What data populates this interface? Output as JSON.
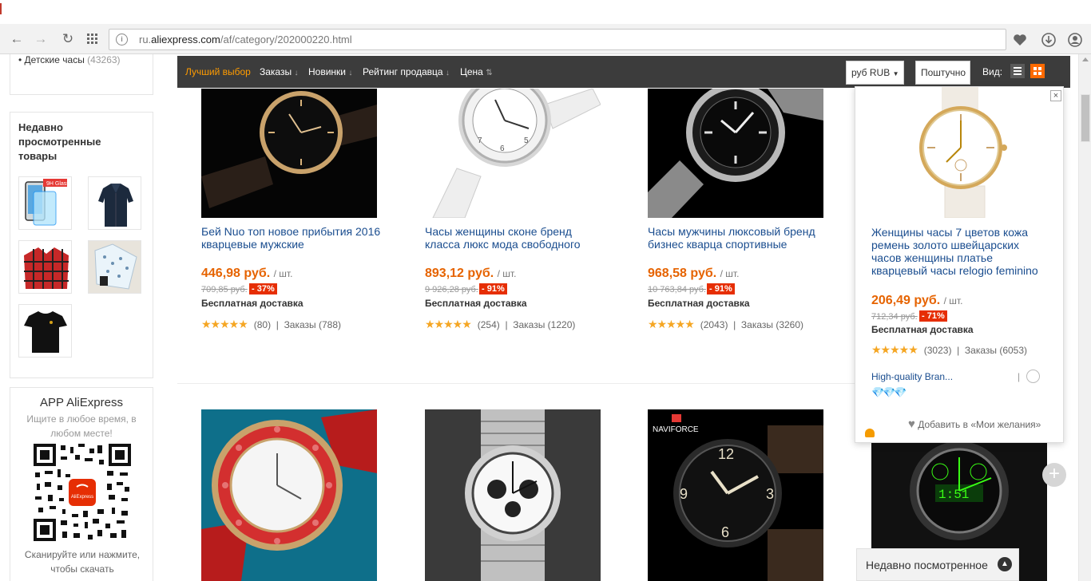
{
  "browser": {
    "url_prefix": "ru.",
    "url_domain": "aliexpress.com",
    "url_path": "/af/category/202000220.html"
  },
  "sidebar": {
    "kids_label": "Детские часы",
    "kids_count": "(43263)",
    "recent_title": "Недавно просмотренные товары",
    "app_title": "APP AliExpress",
    "app_subtitle": "Ищите в любое время, в любом месте!",
    "app_caption": "Сканируйте или нажмите, чтобы скачать",
    "qr_logo": "AliExpress"
  },
  "sortbar": {
    "best": "Лучший выбор",
    "orders": "Заказы",
    "new": "Новинки",
    "seller_rating": "Рейтинг продавца",
    "price": "Цена",
    "currency": "руб RUB",
    "view_mode": "Поштучно",
    "view_label": "Вид:"
  },
  "products": [
    {
      "title": "Бей Nuo топ новое прибытия 2016 кварцевые мужские",
      "price": "446,98 руб.",
      "unit": "/ шт.",
      "old_price": "709,85 руб.",
      "discount": "- 37%",
      "shipping": "Бесплатная доставка",
      "reviews": "(80)",
      "orders": "Заказы (788)"
    },
    {
      "title": "Часы женщины сконе бренд класса люкс мода свободного",
      "price": "893,12 руб.",
      "unit": "/ шт.",
      "old_price": "9 926,28 руб.",
      "discount": "- 91%",
      "shipping": "Бесплатная доставка",
      "reviews": "(254)",
      "orders": "Заказы (1220)"
    },
    {
      "title": "Часы мужчины люксовый бренд бизнес кварца спортивные",
      "price": "968,58 руб.",
      "unit": "/ шт.",
      "old_price": "10 763,84 руб.",
      "discount": "- 91%",
      "shipping": "Бесплатная доставка",
      "reviews": "(2043)",
      "orders": "Заказы (3260)"
    }
  ],
  "popup": {
    "title": "Женщины часы 7 цветов кожа ремень золото швейцарских часов женщины платье кварцевый часы relogio feminino",
    "price": "206,49 руб.",
    "unit": "/ шт.",
    "old_price": "712,34 руб.",
    "discount": "- 71%",
    "shipping": "Бесплатная доставка",
    "reviews": "(3023)",
    "orders": "Заказы (6053)",
    "brand": "High-quality Bran...",
    "wishlist": "Добавить в «Мои желания»"
  },
  "second_row": {
    "naviforce_label": "NAVIFORCE"
  },
  "recent_bar": {
    "label": "Недавно посмотренное"
  },
  "colors": {
    "accent_orange": "#ff9c00",
    "price": "#e66300",
    "discount_bg": "#e62e04",
    "link": "#1a4d8f",
    "sortbar_bg": "#3c3c3c"
  }
}
